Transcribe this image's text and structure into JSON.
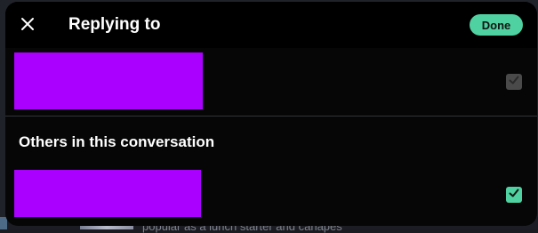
{
  "header": {
    "title": "Replying to",
    "done_label": "Done"
  },
  "background": {
    "partial_text": "popular as a lunch starter and canapes"
  },
  "section": {
    "others_heading": "Others in this conversation"
  },
  "rows": [
    {
      "checked": true,
      "disabled": true
    },
    {
      "checked": true,
      "disabled": false
    }
  ],
  "colors": {
    "accent": "#4fd1a1",
    "redaction": "#aa00ff",
    "modal_bg": "#060606"
  },
  "icons": {
    "close": "close-icon",
    "check": "check-icon"
  }
}
